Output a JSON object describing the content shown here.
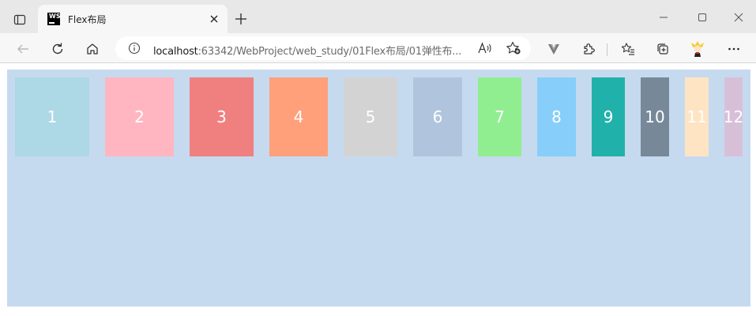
{
  "browser": {
    "tab": {
      "title": "Flex布局",
      "favicon_text": "WS"
    },
    "address_bar": {
      "host": "localhost",
      "path": ":63342/WebProject/web_study/01Flex布局/01弹性布..."
    },
    "window_controls": [
      "minimize",
      "maximize",
      "close"
    ],
    "toolbar_icons": [
      "back-icon",
      "reload-icon",
      "home-icon",
      "info-icon",
      "read-aloud-icon",
      "add-favorite-icon",
      "extension-v-icon",
      "extensions-icon",
      "favorites-icon",
      "collections-icon",
      "profile-icon",
      "more-icon"
    ]
  },
  "page": {
    "container_color": "#c6daef",
    "items": [
      {
        "label": "1",
        "color": "#add8e6"
      },
      {
        "label": "2",
        "color": "#ffb6c1"
      },
      {
        "label": "3",
        "color": "#f08080"
      },
      {
        "label": "4",
        "color": "#ffa07a"
      },
      {
        "label": "5",
        "color": "#d3d3d3"
      },
      {
        "label": "6",
        "color": "#b0c4de"
      },
      {
        "label": "7",
        "color": "#90ee90"
      },
      {
        "label": "8",
        "color": "#87cefa"
      },
      {
        "label": "9",
        "color": "#20b2aa"
      },
      {
        "label": "10",
        "color": "#778899"
      },
      {
        "label": "11",
        "color": "#ffe4c4"
      },
      {
        "label": "12",
        "color": "#d8bfd8"
      }
    ]
  }
}
